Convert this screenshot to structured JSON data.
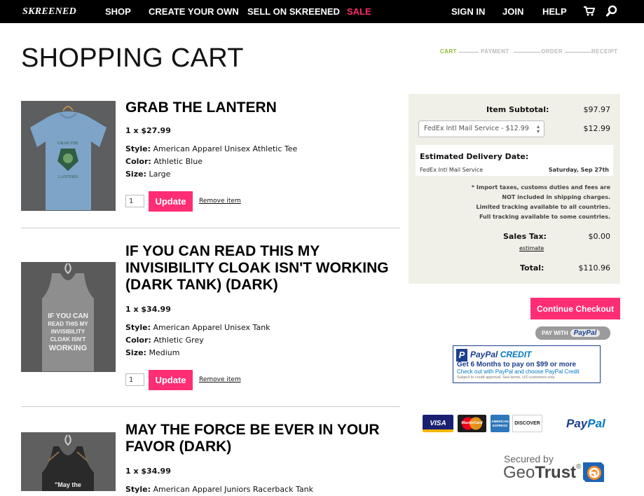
{
  "nav": {
    "brand": "SKREENED",
    "links": [
      "SHOP",
      "CREATE YOUR OWN",
      "SELL ON SKREENED",
      "SALE"
    ],
    "right_links": [
      "SIGN IN",
      "JOIN",
      "HELP"
    ],
    "icons": [
      "cart-icon",
      "search-icon"
    ],
    "sale_color": "#ff2b6b"
  },
  "page": {
    "title": "SHOPPING CART",
    "steps": [
      "CART",
      "PAYMENT",
      "ORDER",
      "RECEIPT"
    ],
    "active_step_color": "#8bbd2c"
  },
  "items": [
    {
      "name": "GRAB THE LANTERN",
      "qty_price": "1 x $27.99",
      "style_label": "Style:",
      "style": "American Apparel Unisex Athletic Tee",
      "color_label": "Color:",
      "color": "Athletic Blue",
      "size_label": "Size:",
      "size": "Large",
      "qty": "1",
      "update": "Update",
      "remove": "Remove item",
      "image_text": "GRAB THE LANTERN"
    },
    {
      "name": "IF YOU CAN READ THIS MY INVISIBILITY CLOAK ISN'T WORKING (DARK TANK) (DARK)",
      "qty_price": "1 x $34.99",
      "style_label": "Style:",
      "style": "American Apparel Unisex Tank",
      "color_label": "Color:",
      "color": "Athletic Grey",
      "size_label": "Size:",
      "size": "Medium",
      "qty": "1",
      "update": "Update",
      "remove": "Remove item",
      "image_text": "IF YOU CAN READ THIS MY INVISIBILITY CLOAK ISN'T WORKING"
    },
    {
      "name": "MAY THE FORCE BE EVER IN YOUR FAVOR (DARK)",
      "qty_price": "1 x $34.99",
      "style_label": "Style:",
      "style": "American Apparel Juniors Racerback Tank",
      "image_text": "\"May the"
    }
  ],
  "summary": {
    "subtotal_label": "Item Subtotal:",
    "subtotal": "$97.97",
    "shipping_option": "FedEx Intl Mail Service - $12.99",
    "shipping": "$12.99",
    "delivery_label": "Estimated Delivery Date:",
    "delivery_service": "FedEx Intl Mail Service",
    "delivery_date": "Saturday, Sep 27th",
    "notes": [
      "* Import taxes, customs duties and fees are",
      "NOT included in shipping charges.",
      "Limited tracking available to all countries.",
      "Full tracking available to some countries."
    ],
    "tax_label": "Sales Tax:",
    "tax": "$0.00",
    "estimate": "estimate",
    "total_label": "Total:",
    "total": "$110.96"
  },
  "checkout": {
    "continue": "Continue Checkout",
    "pay_with": "PAY WITH",
    "paypal": "PayPal",
    "accent": "#ff2d73"
  },
  "paypal_credit": {
    "logo_letter": "P",
    "brand_pay": "PayPal",
    "brand_credit": "CREDIT",
    "line1": "Get 6 Months to pay on $99 or more",
    "line2": "Check out with PayPal and choose PayPal Credit",
    "line3": "Subject to credit approval. See terms. US customers only."
  },
  "cards": [
    "VISA",
    "MasterCard",
    "AMERICAN EXPRESS",
    "DISCOVER"
  ],
  "paypal_logo": {
    "pay": "Pay",
    "pal": "Pal"
  },
  "geotrust": {
    "secured": "Secured by",
    "geo": "Geo",
    "trust": "Trust",
    "reg": "®"
  }
}
